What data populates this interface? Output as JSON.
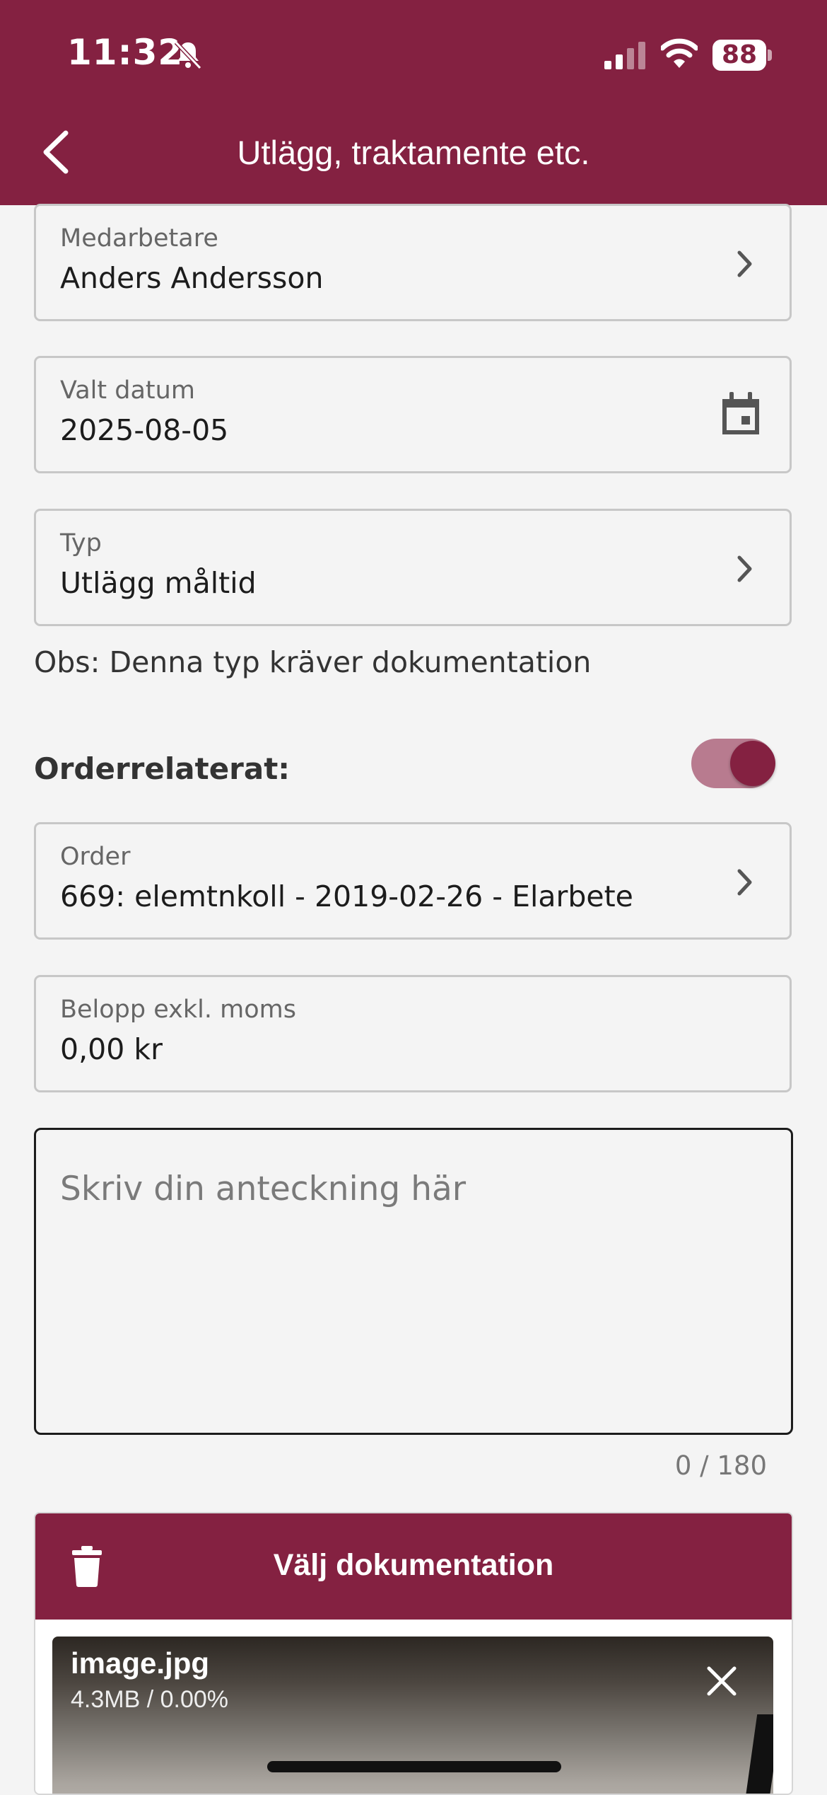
{
  "status": {
    "time": "11:32",
    "battery": "88"
  },
  "header": {
    "title": "Utlägg, traktamente etc."
  },
  "fields": {
    "employee": {
      "label": "Medarbetare",
      "value": "Anders Andersson"
    },
    "date": {
      "label": "Valt datum",
      "value": "2025-08-05"
    },
    "type": {
      "label": "Typ",
      "value": "Utlägg måltid"
    },
    "order": {
      "label": "Order",
      "value": "669: elemtnkoll - 2019-02-26 - Elarbete"
    },
    "amount": {
      "label": "Belopp exkl. moms",
      "value": "0,00 kr"
    }
  },
  "notice": "Obs: Denna typ kräver dokumentation",
  "order_related": {
    "label": "Orderrelaterat:",
    "enabled": true
  },
  "note": {
    "placeholder": "Skriv din anteckning här",
    "value": "",
    "counter": "0 / 180"
  },
  "documentation": {
    "title": "Välj dokumentation",
    "file_name": "image.jpg",
    "file_info": "4.3MB / 0.00%"
  },
  "colors": {
    "brand": "#842141",
    "toggle_track": "#b87b8f",
    "background": "#f4f4f4"
  },
  "icons": [
    "bell-off-icon",
    "signal-icon",
    "wifi-icon",
    "battery-icon",
    "back-icon",
    "chevron-right-icon",
    "calendar-icon",
    "trash-icon",
    "close-icon"
  ]
}
